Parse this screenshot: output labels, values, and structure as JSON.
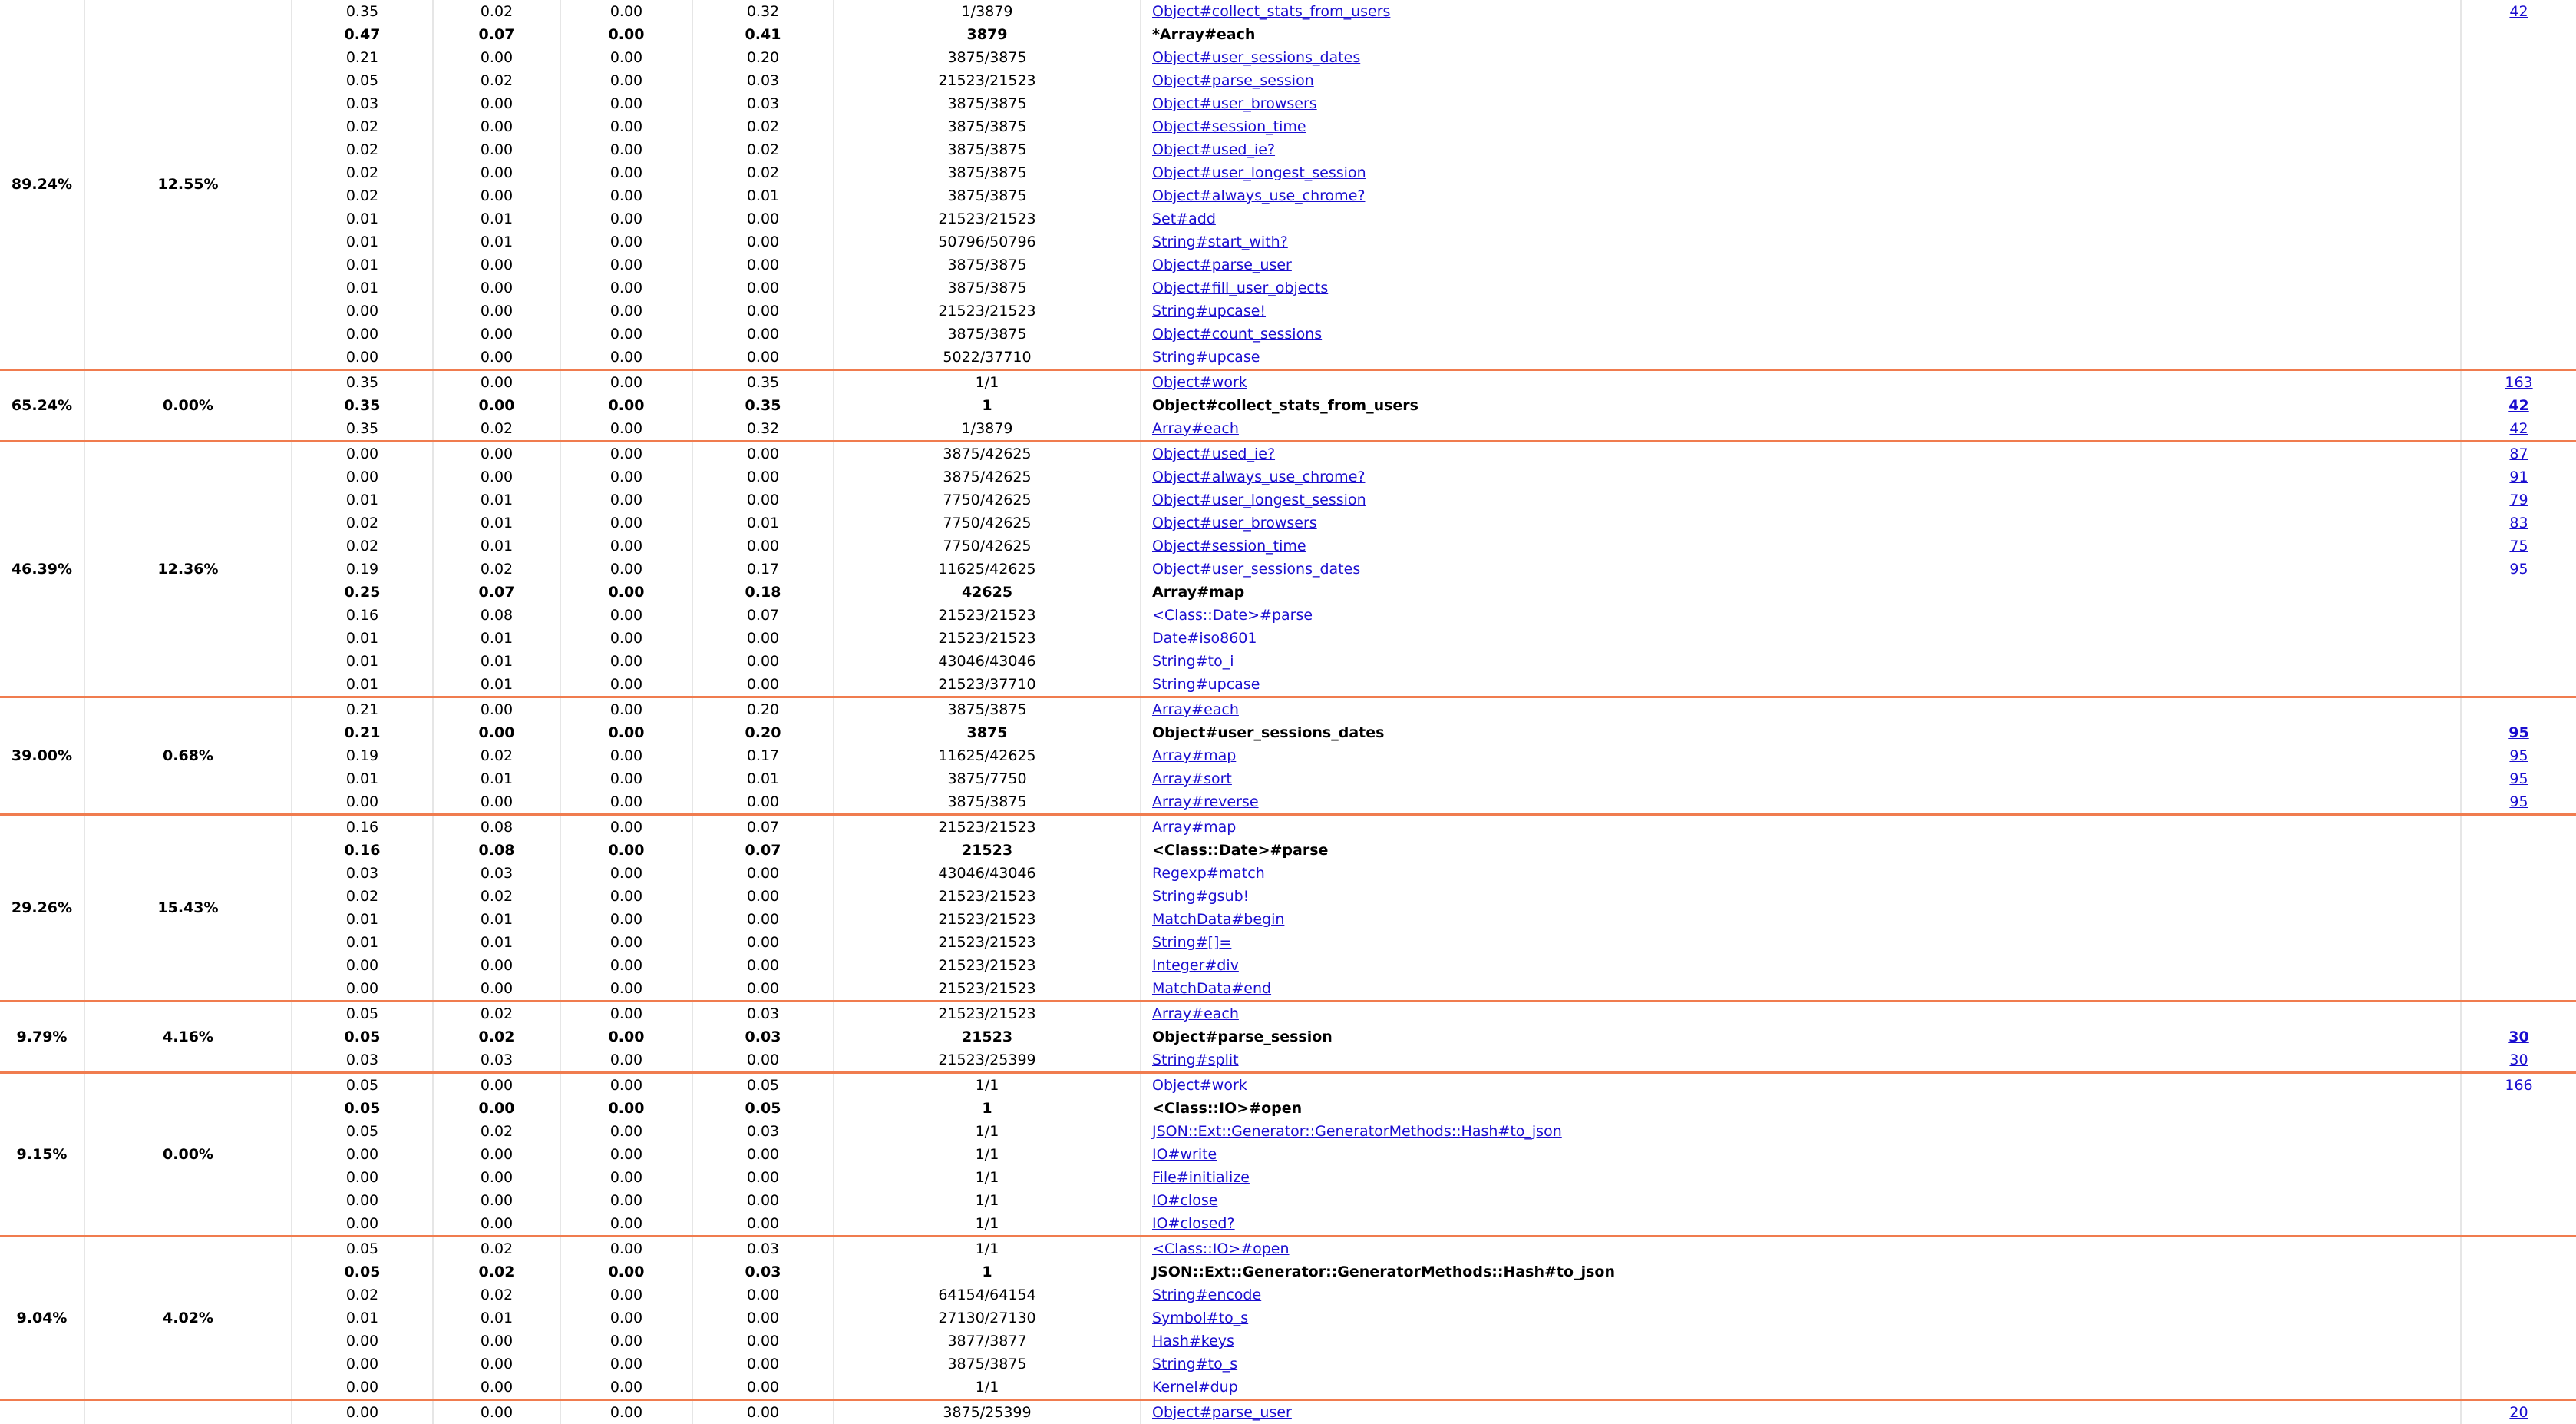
{
  "groups": [
    {
      "total_pct": "89.24%",
      "self_pct": "12.55%",
      "rows": [
        {
          "main": false,
          "total": "0.35",
          "self": "0.02",
          "wait": "0.00",
          "child": "0.32",
          "calls": "1/3879",
          "name": "Object#collect_stats_from_users",
          "link": true,
          "line": "42"
        },
        {
          "main": true,
          "total": "0.47",
          "self": "0.07",
          "wait": "0.00",
          "child": "0.41",
          "calls": "3879",
          "name": "*Array#each",
          "link": false,
          "line": ""
        },
        {
          "main": false,
          "total": "0.21",
          "self": "0.00",
          "wait": "0.00",
          "child": "0.20",
          "calls": "3875/3875",
          "name": "Object#user_sessions_dates",
          "link": true,
          "line": ""
        },
        {
          "main": false,
          "total": "0.05",
          "self": "0.02",
          "wait": "0.00",
          "child": "0.03",
          "calls": "21523/21523",
          "name": "Object#parse_session",
          "link": true,
          "line": ""
        },
        {
          "main": false,
          "total": "0.03",
          "self": "0.00",
          "wait": "0.00",
          "child": "0.03",
          "calls": "3875/3875",
          "name": "Object#user_browsers",
          "link": true,
          "line": ""
        },
        {
          "main": false,
          "total": "0.02",
          "self": "0.00",
          "wait": "0.00",
          "child": "0.02",
          "calls": "3875/3875",
          "name": "Object#session_time",
          "link": true,
          "line": ""
        },
        {
          "main": false,
          "total": "0.02",
          "self": "0.00",
          "wait": "0.00",
          "child": "0.02",
          "calls": "3875/3875",
          "name": "Object#used_ie?",
          "link": true,
          "line": ""
        },
        {
          "main": false,
          "total": "0.02",
          "self": "0.00",
          "wait": "0.00",
          "child": "0.02",
          "calls": "3875/3875",
          "name": "Object#user_longest_session",
          "link": true,
          "line": ""
        },
        {
          "main": false,
          "total": "0.02",
          "self": "0.00",
          "wait": "0.00",
          "child": "0.01",
          "calls": "3875/3875",
          "name": "Object#always_use_chrome?",
          "link": true,
          "line": ""
        },
        {
          "main": false,
          "total": "0.01",
          "self": "0.01",
          "wait": "0.00",
          "child": "0.00",
          "calls": "21523/21523",
          "name": "Set#add",
          "link": true,
          "line": ""
        },
        {
          "main": false,
          "total": "0.01",
          "self": "0.01",
          "wait": "0.00",
          "child": "0.00",
          "calls": "50796/50796",
          "name": "String#start_with?",
          "link": true,
          "line": ""
        },
        {
          "main": false,
          "total": "0.01",
          "self": "0.00",
          "wait": "0.00",
          "child": "0.00",
          "calls": "3875/3875",
          "name": "Object#parse_user",
          "link": true,
          "line": ""
        },
        {
          "main": false,
          "total": "0.01",
          "self": "0.00",
          "wait": "0.00",
          "child": "0.00",
          "calls": "3875/3875",
          "name": "Object#fill_user_objects",
          "link": true,
          "line": ""
        },
        {
          "main": false,
          "total": "0.00",
          "self": "0.00",
          "wait": "0.00",
          "child": "0.00",
          "calls": "21523/21523",
          "name": "String#upcase!",
          "link": true,
          "line": ""
        },
        {
          "main": false,
          "total": "0.00",
          "self": "0.00",
          "wait": "0.00",
          "child": "0.00",
          "calls": "3875/3875",
          "name": "Object#count_sessions",
          "link": true,
          "line": ""
        },
        {
          "main": false,
          "total": "0.00",
          "self": "0.00",
          "wait": "0.00",
          "child": "0.00",
          "calls": "5022/37710",
          "name": "String#upcase",
          "link": true,
          "line": ""
        }
      ]
    },
    {
      "total_pct": "65.24%",
      "self_pct": "0.00%",
      "rows": [
        {
          "main": false,
          "total": "0.35",
          "self": "0.00",
          "wait": "0.00",
          "child": "0.35",
          "calls": "1/1",
          "name": "Object#work",
          "link": true,
          "line": "163"
        },
        {
          "main": true,
          "total": "0.35",
          "self": "0.00",
          "wait": "0.00",
          "child": "0.35",
          "calls": "1",
          "name": "Object#collect_stats_from_users",
          "link": false,
          "line": "42"
        },
        {
          "main": false,
          "total": "0.35",
          "self": "0.02",
          "wait": "0.00",
          "child": "0.32",
          "calls": "1/3879",
          "name": "Array#each",
          "link": true,
          "line": "42"
        }
      ]
    },
    {
      "total_pct": "46.39%",
      "self_pct": "12.36%",
      "rows": [
        {
          "main": false,
          "total": "0.00",
          "self": "0.00",
          "wait": "0.00",
          "child": "0.00",
          "calls": "3875/42625",
          "name": "Object#used_ie?",
          "link": true,
          "line": "87"
        },
        {
          "main": false,
          "total": "0.00",
          "self": "0.00",
          "wait": "0.00",
          "child": "0.00",
          "calls": "3875/42625",
          "name": "Object#always_use_chrome?",
          "link": true,
          "line": "91"
        },
        {
          "main": false,
          "total": "0.01",
          "self": "0.01",
          "wait": "0.00",
          "child": "0.00",
          "calls": "7750/42625",
          "name": "Object#user_longest_session",
          "link": true,
          "line": "79"
        },
        {
          "main": false,
          "total": "0.02",
          "self": "0.01",
          "wait": "0.00",
          "child": "0.01",
          "calls": "7750/42625",
          "name": "Object#user_browsers",
          "link": true,
          "line": "83"
        },
        {
          "main": false,
          "total": "0.02",
          "self": "0.01",
          "wait": "0.00",
          "child": "0.00",
          "calls": "7750/42625",
          "name": "Object#session_time",
          "link": true,
          "line": "75"
        },
        {
          "main": false,
          "total": "0.19",
          "self": "0.02",
          "wait": "0.00",
          "child": "0.17",
          "calls": "11625/42625",
          "name": "Object#user_sessions_dates",
          "link": true,
          "line": "95"
        },
        {
          "main": true,
          "total": "0.25",
          "self": "0.07",
          "wait": "0.00",
          "child": "0.18",
          "calls": "42625",
          "name": "Array#map",
          "link": false,
          "line": ""
        },
        {
          "main": false,
          "total": "0.16",
          "self": "0.08",
          "wait": "0.00",
          "child": "0.07",
          "calls": "21523/21523",
          "name": "<Class::Date>#parse",
          "link": true,
          "line": ""
        },
        {
          "main": false,
          "total": "0.01",
          "self": "0.01",
          "wait": "0.00",
          "child": "0.00",
          "calls": "21523/21523",
          "name": "Date#iso8601",
          "link": true,
          "line": ""
        },
        {
          "main": false,
          "total": "0.01",
          "self": "0.01",
          "wait": "0.00",
          "child": "0.00",
          "calls": "43046/43046",
          "name": "String#to_i",
          "link": true,
          "line": ""
        },
        {
          "main": false,
          "total": "0.01",
          "self": "0.01",
          "wait": "0.00",
          "child": "0.00",
          "calls": "21523/37710",
          "name": "String#upcase",
          "link": true,
          "line": ""
        }
      ]
    },
    {
      "total_pct": "39.00%",
      "self_pct": "0.68%",
      "rows": [
        {
          "main": false,
          "total": "0.21",
          "self": "0.00",
          "wait": "0.00",
          "child": "0.20",
          "calls": "3875/3875",
          "name": "Array#each",
          "link": true,
          "line": ""
        },
        {
          "main": true,
          "total": "0.21",
          "self": "0.00",
          "wait": "0.00",
          "child": "0.20",
          "calls": "3875",
          "name": "Object#user_sessions_dates",
          "link": false,
          "line": "95"
        },
        {
          "main": false,
          "total": "0.19",
          "self": "0.02",
          "wait": "0.00",
          "child": "0.17",
          "calls": "11625/42625",
          "name": "Array#map",
          "link": true,
          "line": "95"
        },
        {
          "main": false,
          "total": "0.01",
          "self": "0.01",
          "wait": "0.00",
          "child": "0.01",
          "calls": "3875/7750",
          "name": "Array#sort",
          "link": true,
          "line": "95"
        },
        {
          "main": false,
          "total": "0.00",
          "self": "0.00",
          "wait": "0.00",
          "child": "0.00",
          "calls": "3875/3875",
          "name": "Array#reverse",
          "link": true,
          "line": "95"
        }
      ]
    },
    {
      "total_pct": "29.26%",
      "self_pct": "15.43%",
      "rows": [
        {
          "main": false,
          "total": "0.16",
          "self": "0.08",
          "wait": "0.00",
          "child": "0.07",
          "calls": "21523/21523",
          "name": "Array#map",
          "link": true,
          "line": ""
        },
        {
          "main": true,
          "total": "0.16",
          "self": "0.08",
          "wait": "0.00",
          "child": "0.07",
          "calls": "21523",
          "name": "<Class::Date>#parse",
          "link": false,
          "line": ""
        },
        {
          "main": false,
          "total": "0.03",
          "self": "0.03",
          "wait": "0.00",
          "child": "0.00",
          "calls": "43046/43046",
          "name": "Regexp#match",
          "link": true,
          "line": ""
        },
        {
          "main": false,
          "total": "0.02",
          "self": "0.02",
          "wait": "0.00",
          "child": "0.00",
          "calls": "21523/21523",
          "name": "String#gsub!",
          "link": true,
          "line": ""
        },
        {
          "main": false,
          "total": "0.01",
          "self": "0.01",
          "wait": "0.00",
          "child": "0.00",
          "calls": "21523/21523",
          "name": "MatchData#begin",
          "link": true,
          "line": ""
        },
        {
          "main": false,
          "total": "0.01",
          "self": "0.01",
          "wait": "0.00",
          "child": "0.00",
          "calls": "21523/21523",
          "name": "String#[]=",
          "link": true,
          "line": ""
        },
        {
          "main": false,
          "total": "0.00",
          "self": "0.00",
          "wait": "0.00",
          "child": "0.00",
          "calls": "21523/21523",
          "name": "Integer#div",
          "link": true,
          "line": ""
        },
        {
          "main": false,
          "total": "0.00",
          "self": "0.00",
          "wait": "0.00",
          "child": "0.00",
          "calls": "21523/21523",
          "name": "MatchData#end",
          "link": true,
          "line": ""
        }
      ]
    },
    {
      "total_pct": "9.79%",
      "self_pct": "4.16%",
      "rows": [
        {
          "main": false,
          "total": "0.05",
          "self": "0.02",
          "wait": "0.00",
          "child": "0.03",
          "calls": "21523/21523",
          "name": "Array#each",
          "link": true,
          "line": ""
        },
        {
          "main": true,
          "total": "0.05",
          "self": "0.02",
          "wait": "0.00",
          "child": "0.03",
          "calls": "21523",
          "name": "Object#parse_session",
          "link": false,
          "line": "30"
        },
        {
          "main": false,
          "total": "0.03",
          "self": "0.03",
          "wait": "0.00",
          "child": "0.00",
          "calls": "21523/25399",
          "name": "String#split",
          "link": true,
          "line": "30"
        }
      ]
    },
    {
      "total_pct": "9.15%",
      "self_pct": "0.00%",
      "rows": [
        {
          "main": false,
          "total": "0.05",
          "self": "0.00",
          "wait": "0.00",
          "child": "0.05",
          "calls": "1/1",
          "name": "Object#work",
          "link": true,
          "line": "166"
        },
        {
          "main": true,
          "total": "0.05",
          "self": "0.00",
          "wait": "0.00",
          "child": "0.05",
          "calls": "1",
          "name": "<Class::IO>#open",
          "link": false,
          "line": ""
        },
        {
          "main": false,
          "total": "0.05",
          "self": "0.02",
          "wait": "0.00",
          "child": "0.03",
          "calls": "1/1",
          "name": "JSON::Ext::Generator::GeneratorMethods::Hash#to_json",
          "link": true,
          "line": ""
        },
        {
          "main": false,
          "total": "0.00",
          "self": "0.00",
          "wait": "0.00",
          "child": "0.00",
          "calls": "1/1",
          "name": "IO#write",
          "link": true,
          "line": ""
        },
        {
          "main": false,
          "total": "0.00",
          "self": "0.00",
          "wait": "0.00",
          "child": "0.00",
          "calls": "1/1",
          "name": "File#initialize",
          "link": true,
          "line": ""
        },
        {
          "main": false,
          "total": "0.00",
          "self": "0.00",
          "wait": "0.00",
          "child": "0.00",
          "calls": "1/1",
          "name": "IO#close",
          "link": true,
          "line": ""
        },
        {
          "main": false,
          "total": "0.00",
          "self": "0.00",
          "wait": "0.00",
          "child": "0.00",
          "calls": "1/1",
          "name": "IO#closed?",
          "link": true,
          "line": ""
        }
      ]
    },
    {
      "total_pct": "9.04%",
      "self_pct": "4.02%",
      "rows": [
        {
          "main": false,
          "total": "0.05",
          "self": "0.02",
          "wait": "0.00",
          "child": "0.03",
          "calls": "1/1",
          "name": "<Class::IO>#open",
          "link": true,
          "line": ""
        },
        {
          "main": true,
          "total": "0.05",
          "self": "0.02",
          "wait": "0.00",
          "child": "0.03",
          "calls": "1",
          "name": "JSON::Ext::Generator::GeneratorMethods::Hash#to_json",
          "link": false,
          "line": ""
        },
        {
          "main": false,
          "total": "0.02",
          "self": "0.02",
          "wait": "0.00",
          "child": "0.00",
          "calls": "64154/64154",
          "name": "String#encode",
          "link": true,
          "line": ""
        },
        {
          "main": false,
          "total": "0.01",
          "self": "0.01",
          "wait": "0.00",
          "child": "0.00",
          "calls": "27130/27130",
          "name": "Symbol#to_s",
          "link": true,
          "line": ""
        },
        {
          "main": false,
          "total": "0.00",
          "self": "0.00",
          "wait": "0.00",
          "child": "0.00",
          "calls": "3877/3877",
          "name": "Hash#keys",
          "link": true,
          "line": ""
        },
        {
          "main": false,
          "total": "0.00",
          "self": "0.00",
          "wait": "0.00",
          "child": "0.00",
          "calls": "3875/3875",
          "name": "String#to_s",
          "link": true,
          "line": ""
        },
        {
          "main": false,
          "total": "0.00",
          "self": "0.00",
          "wait": "0.00",
          "child": "0.00",
          "calls": "1/1",
          "name": "Kernel#dup",
          "link": true,
          "line": ""
        }
      ]
    },
    {
      "total_pct": "",
      "self_pct": "",
      "rows": [
        {
          "main": false,
          "total": "0.00",
          "self": "0.00",
          "wait": "0.00",
          "child": "0.00",
          "calls": "3875/25399",
          "name": "Object#parse_user",
          "link": true,
          "line": "20"
        }
      ]
    }
  ]
}
